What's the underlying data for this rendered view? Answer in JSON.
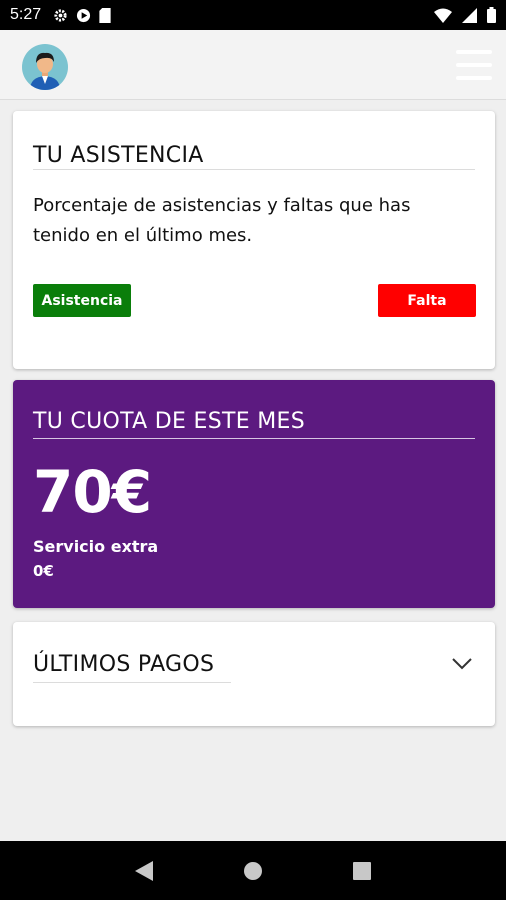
{
  "status_bar": {
    "time": "5:27",
    "left_icons": [
      "gear-icon",
      "play-icon",
      "sd-card-icon"
    ],
    "right_icons": [
      "wifi-icon",
      "signal-icon",
      "battery-icon"
    ]
  },
  "header": {
    "avatar": "avatar",
    "menu_icon": "hamburger-menu-icon"
  },
  "attendance": {
    "title": "TU ASISTENCIA",
    "description": "Porcentaje de asistencias y faltas que has tenido en el último mes.",
    "present_label": "Asistencia",
    "absent_label": "Falta",
    "colors": {
      "present": "#0a7e0a",
      "absent": "#ff0000"
    }
  },
  "fee": {
    "title": "TU CUOTA DE ESTE MES",
    "amount": "70€",
    "extra_label": "Servicio extra",
    "extra_value": "0€",
    "color": "#5c1a80"
  },
  "payments": {
    "title": "ÚLTIMOS PAGOS",
    "toggle_icon": "chevron-down-icon"
  },
  "nav": {
    "buttons": [
      "back-icon",
      "home-icon",
      "recents-icon"
    ]
  }
}
